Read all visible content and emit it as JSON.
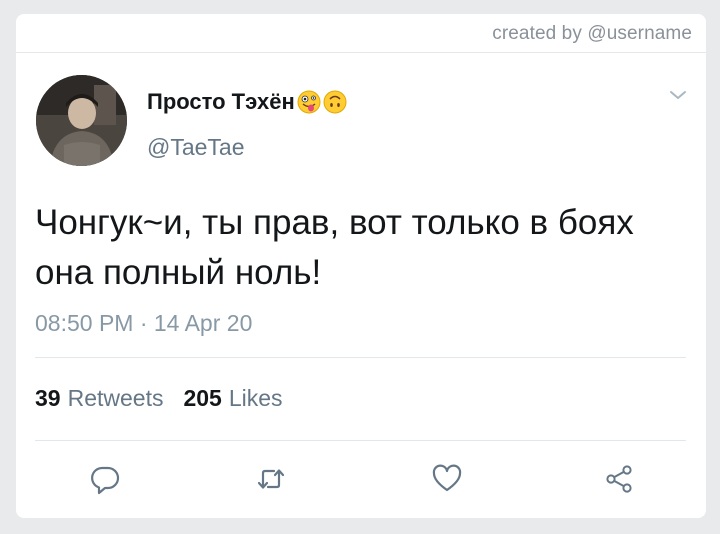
{
  "credit": "created by @username",
  "user": {
    "display_name": "Просто Тэхён",
    "emojis": [
      "zany-face-emoji",
      "upside-down-face-emoji"
    ],
    "handle": "@TaeTae"
  },
  "tweet": {
    "text": "Чонгук~и, ты прав, вот только в боях она полный ноль!",
    "timestamp": "08:50 PM · 14 Apr 20"
  },
  "stats": {
    "retweets_count": "39",
    "retweets_label": "Retweets",
    "likes_count": "205",
    "likes_label": "Likes"
  },
  "actions": [
    {
      "name": "reply",
      "icon": "reply-icon"
    },
    {
      "name": "retweet",
      "icon": "retweet-icon"
    },
    {
      "name": "like",
      "icon": "heart-icon"
    },
    {
      "name": "share",
      "icon": "share-icon"
    }
  ],
  "colors": {
    "icon_gray": "#657786",
    "text_primary": "#14171a",
    "text_secondary": "#657786",
    "emoji_yellow": "#ffcc33"
  }
}
